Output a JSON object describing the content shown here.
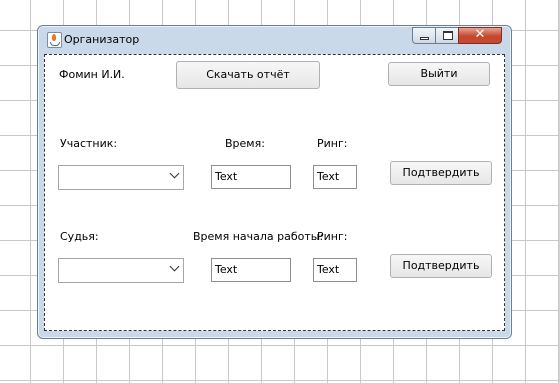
{
  "window": {
    "title": "Организатор",
    "controls": {
      "minimize": "minimize",
      "maximize": "maximize",
      "close": "✕"
    }
  },
  "header": {
    "user_name": "Фомин И.И.",
    "download_report_label": "Скачать отчёт",
    "logout_label": "Выйти"
  },
  "participant_section": {
    "participant_label": "Участник:",
    "time_label": "Время:",
    "ring_label": "Ринг:",
    "participant_selected": "",
    "time_value": "Text",
    "ring_value": "Text",
    "confirm_label": "Подтвердить"
  },
  "judge_section": {
    "judge_label": "Судья:",
    "start_time_label": "Время начала работы:",
    "ring_label": "Ринг:",
    "judge_selected": "",
    "start_time_value": "Text",
    "ring_value": "Text",
    "confirm_label": "Подтвердить"
  },
  "icons": [
    "app-java-icon",
    "minimize-icon",
    "maximize-icon",
    "close-icon",
    "chevron-down-icon"
  ]
}
